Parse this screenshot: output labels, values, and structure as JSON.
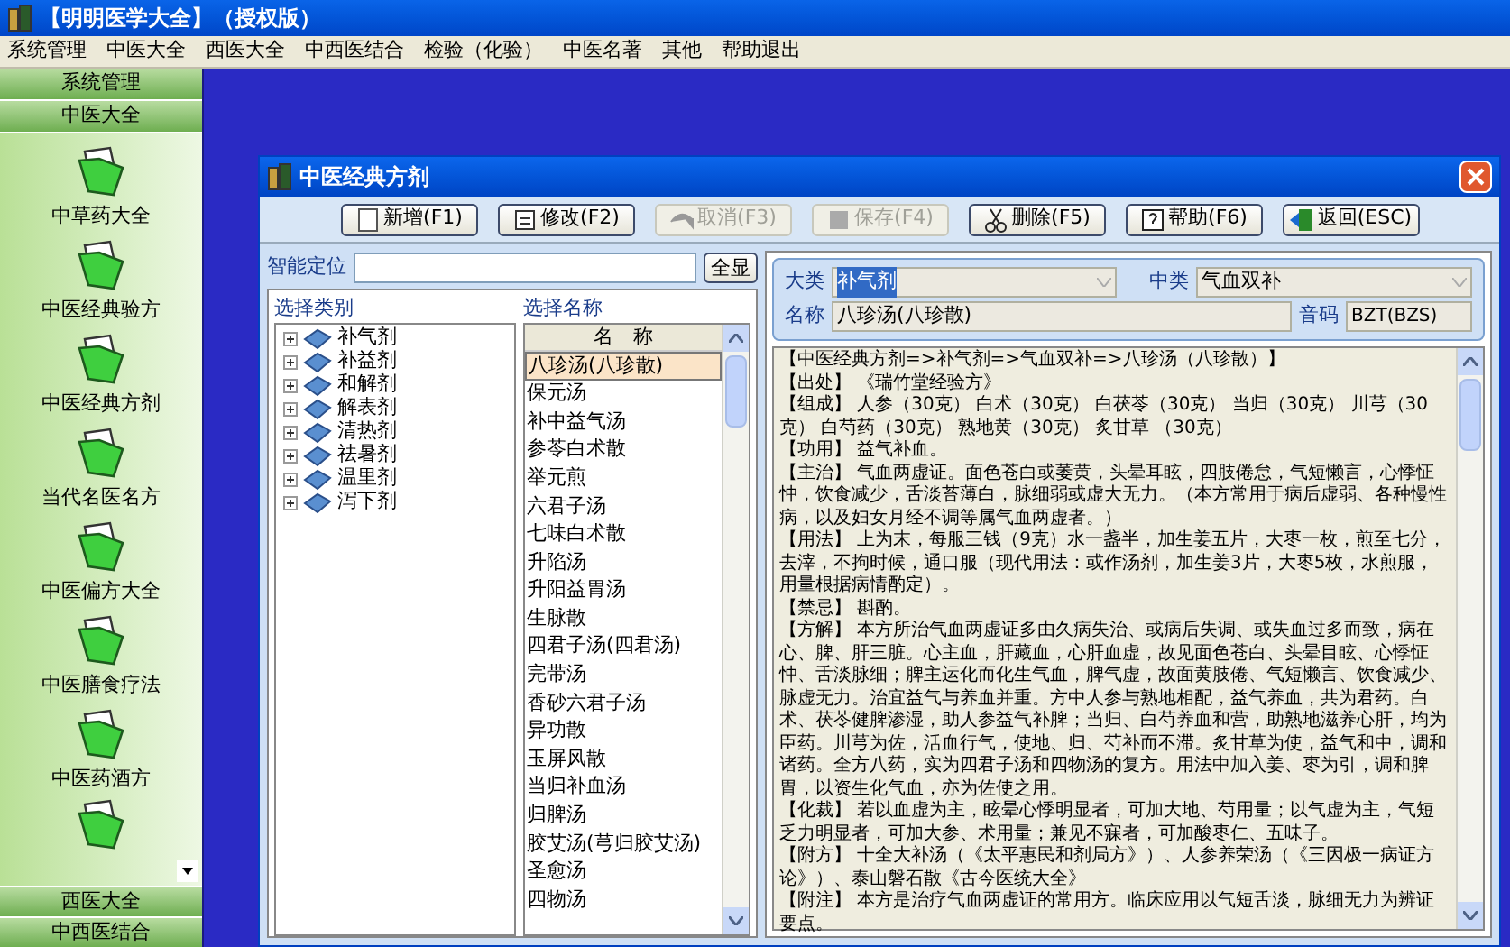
{
  "window": {
    "title": "【明明医学大全】（授权版）"
  },
  "menu": [
    "系统管理",
    "中医大全",
    "西医大全",
    "中西医结合",
    "检验（化验）",
    "中医名著",
    "其他",
    "帮助退出"
  ],
  "sidebar": {
    "top_sections": [
      "系统管理",
      "中医大全"
    ],
    "items": [
      {
        "label": "中草药大全"
      },
      {
        "label": "中医经典验方"
      },
      {
        "label": "中医经典方剂"
      },
      {
        "label": "当代名医名方"
      },
      {
        "label": "中医偏方大全"
      },
      {
        "label": "中医膳食疗法"
      },
      {
        "label": "中医药酒方"
      }
    ],
    "bottom_sections": [
      "西医大全",
      "中西医结合"
    ]
  },
  "dialog": {
    "title": "中医经典方剂",
    "toolbar": [
      {
        "label": "新增(F1)",
        "kind": "new",
        "disabled": false
      },
      {
        "label": "修改(F2)",
        "kind": "edit",
        "disabled": false
      },
      {
        "label": "取消(F3)",
        "kind": "cancel",
        "disabled": true
      },
      {
        "label": "保存(F4)",
        "kind": "save",
        "disabled": true
      },
      {
        "label": "删除(F5)",
        "kind": "delete",
        "disabled": false
      },
      {
        "label": "帮助(F6)",
        "kind": "help",
        "disabled": false
      },
      {
        "label": "返回(ESC)",
        "kind": "back",
        "disabled": false
      }
    ],
    "search": {
      "label": "智能定位",
      "button": "全显"
    },
    "categories": {
      "title": "选择类别",
      "items": [
        {
          "label": "补气剂",
          "expanded": false
        },
        {
          "label": "补益剂",
          "expanded": false
        },
        {
          "label": "和解剂",
          "expanded": false
        },
        {
          "label": "解表剂",
          "expanded": false
        },
        {
          "label": "清热剂",
          "expanded": false
        },
        {
          "label": "祛暑剂",
          "expanded": false
        },
        {
          "label": "温里剂",
          "expanded": false
        },
        {
          "label": "泻下剂",
          "expanded": false
        }
      ]
    },
    "names": {
      "title": "选择名称",
      "column": "名　称",
      "items": [
        {
          "label": "八珍汤(八珍散)",
          "selected": true
        },
        {
          "label": "保元汤",
          "selected": false
        },
        {
          "label": "补中益气汤",
          "selected": false
        },
        {
          "label": "参苓白术散",
          "selected": false
        },
        {
          "label": "举元煎",
          "selected": false
        },
        {
          "label": "六君子汤",
          "selected": false
        },
        {
          "label": "七味白术散",
          "selected": false
        },
        {
          "label": "升陷汤",
          "selected": false
        },
        {
          "label": "升阳益胃汤",
          "selected": false
        },
        {
          "label": "生脉散",
          "selected": false
        },
        {
          "label": "四君子汤(四君汤)",
          "selected": false
        },
        {
          "label": "完带汤",
          "selected": false
        },
        {
          "label": "香砂六君子汤",
          "selected": false
        },
        {
          "label": "异功散",
          "selected": false
        },
        {
          "label": "玉屏风散",
          "selected": false
        },
        {
          "label": "当归补血汤",
          "selected": false
        },
        {
          "label": "归脾汤",
          "selected": false
        },
        {
          "label": "胶艾汤(芎归胶艾汤)",
          "selected": false
        },
        {
          "label": "圣愈汤",
          "selected": false
        },
        {
          "label": "四物汤",
          "selected": false
        }
      ]
    },
    "fields": {
      "major": {
        "label": "大类",
        "value": "补气剂",
        "highlighted": true
      },
      "minor": {
        "label": "中类",
        "value": "气血双补"
      },
      "name": {
        "label": "名称",
        "value": "八珍汤(八珍散)"
      },
      "code": {
        "label": "音码",
        "value": "BZT(BZS)"
      }
    },
    "content": [
      "【中医经典方剂=>补气剂=>气血双补=>八珍汤（八珍散）】",
      "【出处】 《瑞竹堂经验方》",
      "【组成】 人参（30克） 白术（30克） 白茯苓（30克） 当归（30克） 川芎（30克） 白芍药（30克） 熟地黄（30克） 炙甘草 （30克）",
      "【功用】 益气补血。",
      "【主治】 气血两虚证。面色苍白或萎黄，头晕耳眩，四肢倦怠，气短懒言，心悸怔忡，饮食减少，舌淡苔薄白，脉细弱或虚大无力。（本方常用于病后虚弱、各种慢性病，以及妇女月经不调等属气血两虚者。）",
      "【用法】 上为末，每服三钱（9克）水一盏半，加生姜五片，大枣一枚，煎至七分，去滓，不拘时候，通口服（现代用法：或作汤剂，加生姜3片，大枣5枚，水煎服，用量根据病情酌定）。",
      "【禁忌】 斟酌。",
      "【方解】 本方所治气血两虚证多由久病失治、或病后失调、或失血过多而致，病在心、脾、肝三脏。心主血，肝藏血，心肝血虚，故见面色苍白、头晕目眩、心悸怔忡、舌淡脉细；脾主运化而化生气血，脾气虚，故面黄肢倦、气短懒言、饮食减少、脉虚无力。治宜益气与养血并重。方中人参与熟地相配，益气养血，共为君药。白术、茯苓健脾渗湿，助人参益气补脾；当归、白芍养血和营，助熟地滋养心肝，均为臣药。川芎为佐，活血行气，使地、归、芍补而不滞。炙甘草为使，益气和中，调和诸药。全方八药，实为四君子汤和四物汤的复方。用法中加入姜、枣为引，调和脾胃，以资生化气血，亦为佐使之用。",
      "【化裁】 若以血虚为主，眩晕心悸明显者，可加大地、芍用量；以气虚为主，气短乏力明显者，可加大参、术用量；兼见不寐者，可加酸枣仁、五味子。",
      "【附方】 十全大补汤（《太平惠民和剂局方》）、人参养荣汤（《三因极一病证方论》）、泰山磐石散《古今医统大全》",
      "【附注】 本方是治疗气血两虚证的常用方。临床应用以气短舌淡，脉细无力为辨证要点。"
    ]
  }
}
